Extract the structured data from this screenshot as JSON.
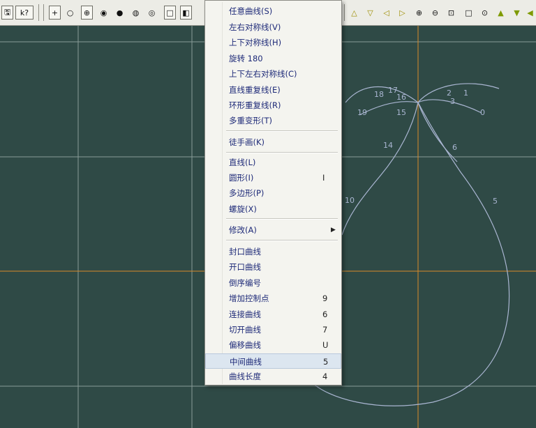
{
  "toolbar": {
    "left_buttons": [
      {
        "name": "save-icon",
        "glyph": "🖫"
      },
      {
        "name": "help-cursor-icon",
        "glyph": "k?"
      }
    ],
    "snap_buttons": [
      {
        "name": "snap-point-icon",
        "glyph": "+"
      },
      {
        "name": "snap-circle-icon",
        "glyph": "○"
      },
      {
        "name": "snap-crosshair-icon",
        "glyph": "⊕"
      },
      {
        "name": "snap-filled-circle-icon",
        "glyph": "◉"
      },
      {
        "name": "snap-dot-icon",
        "glyph": "●"
      },
      {
        "name": "snap-ring-icon",
        "glyph": "◍"
      },
      {
        "name": "snap-ring-number-icon",
        "glyph": "◎"
      },
      {
        "name": "snap-square-icon",
        "glyph": "□"
      },
      {
        "name": "snap-half-square-icon",
        "glyph": "◧"
      }
    ],
    "right_buttons": [
      {
        "name": "arrow-up-icon",
        "glyph": "△"
      },
      {
        "name": "arrow-down-icon",
        "glyph": "▽"
      },
      {
        "name": "arrow-left-icon",
        "glyph": "◁"
      },
      {
        "name": "arrow-right-icon",
        "glyph": "▷"
      },
      {
        "name": "zoom-in-icon",
        "glyph": "⊕"
      },
      {
        "name": "zoom-out-icon",
        "glyph": "⊖"
      },
      {
        "name": "zoom-window-icon",
        "glyph": "⊡"
      },
      {
        "name": "zoom-box-icon",
        "glyph": "□"
      },
      {
        "name": "zoom-fit-icon",
        "glyph": "⊙"
      },
      {
        "name": "arrow-up-filled-icon",
        "glyph": "▲"
      },
      {
        "name": "arrow-down-filled-icon",
        "glyph": "▼"
      },
      {
        "name": "arrow-left-filled-icon",
        "glyph": "◀"
      }
    ]
  },
  "canvas": {
    "background_color": "#2f4a46",
    "grid_color": "#a9b8b4",
    "axis_color": "#d98a2a",
    "curve_color": "#aab6d2",
    "point_labels": [
      "18",
      "17",
      "16",
      "19",
      "15",
      "14",
      "2",
      "3",
      "1",
      "0",
      "6",
      "5",
      "10"
    ]
  },
  "menu": {
    "items": [
      {
        "label": "任意曲线(S)",
        "shortcut": ""
      },
      {
        "label": "左右对称线(V)",
        "shortcut": ""
      },
      {
        "label": "上下对称线(H)",
        "shortcut": ""
      },
      {
        "label": "旋转 180",
        "shortcut": ""
      },
      {
        "label": "上下左右对称线(C)",
        "shortcut": ""
      },
      {
        "label": "直线重复线(E)",
        "shortcut": ""
      },
      {
        "label": "环形重复线(R)",
        "shortcut": ""
      },
      {
        "label": "多重变形(T)",
        "shortcut": ""
      },
      {
        "label": "徒手画(K)",
        "shortcut": ""
      },
      {
        "label": "直线(L)",
        "shortcut": ""
      },
      {
        "label": "圆形(I)",
        "shortcut": "I"
      },
      {
        "label": "多边形(P)",
        "shortcut": ""
      },
      {
        "label": "螺旋(X)",
        "shortcut": ""
      },
      {
        "label": "修改(A)",
        "shortcut": "",
        "submenu": true
      },
      {
        "label": "封口曲线",
        "shortcut": ""
      },
      {
        "label": "开口曲线",
        "shortcut": ""
      },
      {
        "label": "倒序编号",
        "shortcut": ""
      },
      {
        "label": "增加控制点",
        "shortcut": "9"
      },
      {
        "label": "连接曲线",
        "shortcut": "6"
      },
      {
        "label": "切开曲线",
        "shortcut": "7"
      },
      {
        "label": "偏移曲线",
        "shortcut": "U"
      },
      {
        "label": "中间曲线",
        "shortcut": "5",
        "highlighted": true
      },
      {
        "label": "曲线长度",
        "shortcut": "4"
      }
    ]
  }
}
